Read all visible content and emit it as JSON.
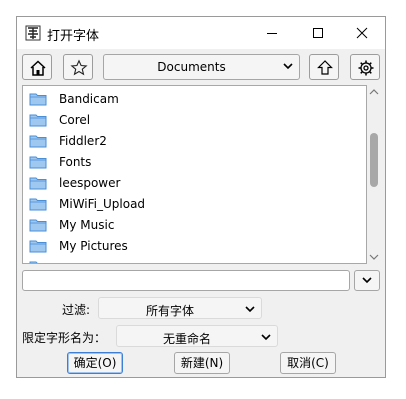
{
  "window": {
    "title": "打开字体",
    "controls": {
      "minimize": "minimize",
      "maximize": "maximize",
      "close": "close"
    }
  },
  "toolbar": {
    "home_icon": "home-icon",
    "bookmark_icon": "star-icon",
    "location": "Documents",
    "up_icon": "up-arrow-icon",
    "settings_icon": "gear-icon"
  },
  "files": [
    {
      "name": "Bandicam",
      "icon": "folder-icon"
    },
    {
      "name": "Corel",
      "icon": "folder-icon"
    },
    {
      "name": "Fiddler2",
      "icon": "folder-icon"
    },
    {
      "name": "Fonts",
      "icon": "folder-icon"
    },
    {
      "name": "leespower",
      "icon": "folder-icon"
    },
    {
      "name": "MiWiFi_Upload",
      "icon": "folder-icon"
    },
    {
      "name": "My Music",
      "icon": "folder-icon"
    },
    {
      "name": "My Pictures",
      "icon": "folder-icon"
    }
  ],
  "filename": {
    "value": ""
  },
  "filter": {
    "label": "过滤:",
    "value": "所有字体"
  },
  "rename": {
    "label": "限定字形名为：",
    "value": "无重命名"
  },
  "buttons": {
    "ok": "确定(O)",
    "new": "新建(N)",
    "cancel": "取消(C)"
  },
  "colors": {
    "folder": "#9ec8f0",
    "folder_border": "#4a8ed6",
    "accent": "#3c7fd4"
  }
}
